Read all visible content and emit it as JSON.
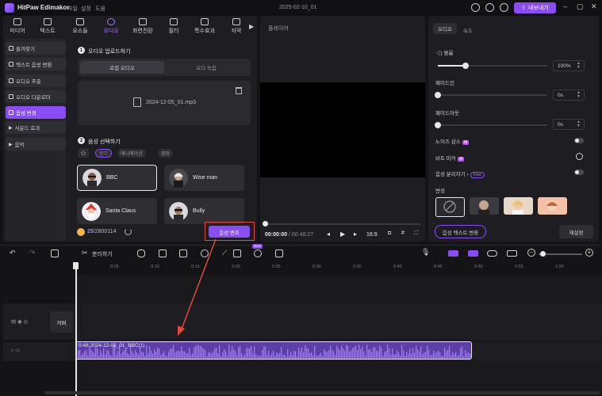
{
  "titlebar": {
    "app_name": "HitPaw Edimakor",
    "menu": [
      "파일",
      "설정",
      "도움"
    ],
    "document_title": "2025-02-10_01",
    "export_label": "내보내기"
  },
  "tool_tabs": [
    {
      "label": "미디어"
    },
    {
      "label": "텍스트"
    },
    {
      "label": "요소들"
    },
    {
      "label": "오디오"
    },
    {
      "label": "화면전환"
    },
    {
      "label": "필터"
    },
    {
      "label": "특수효과"
    },
    {
      "label": "자막"
    }
  ],
  "sidebar": {
    "items": [
      {
        "label": "즐겨찾기"
      },
      {
        "label": "텍스트 음성 변환"
      },
      {
        "label": "오디오 추출"
      },
      {
        "label": "오디오 다운로더"
      },
      {
        "label": "음성 변경"
      },
      {
        "label": "사운드 효과"
      },
      {
        "label": "음악"
      }
    ]
  },
  "upload": {
    "step_number": "1",
    "heading": "오디오 업로드하기",
    "options": [
      "로컬 오디오",
      "오디 녹음"
    ],
    "file_name": "2024-12-05_01.mp3"
  },
  "voice_select": {
    "step_number": "2",
    "heading": "음성 선택하기",
    "filters": [
      "인기",
      "애니메이션",
      "영화"
    ],
    "star": "☆",
    "voices": [
      {
        "name": "BBC"
      },
      {
        "name": "Wise man"
      },
      {
        "name": "Santa Claus"
      },
      {
        "name": "Bully"
      }
    ]
  },
  "footer": {
    "credits_used": "25",
    "credits_total": "/2800114",
    "convert_label": "음성 변조"
  },
  "player": {
    "label": "플레이어",
    "time_current": "00:00:00",
    "time_total": "/ 00:48:27",
    "aspect": "16:9"
  },
  "properties": {
    "tabs": [
      "오디오",
      "속도"
    ],
    "volume_label": "볼륨",
    "volume_value": "100%",
    "fade_in_label": "페이드인",
    "fade_in_value": "0s",
    "fade_out_label": "페이드아웃",
    "fade_out_value": "0s",
    "noise_label": "노이즈 감소",
    "beat_label": "비트 마커",
    "vocal_label": "음성 분리하기",
    "ai_badge": "AI",
    "free_badge": "Free",
    "voice_change_label": "변성",
    "speech_text_label": "음성 텍스트 변환",
    "reset_label": "재설정",
    "volume_level": 0.25,
    "fade_in_level": 0,
    "fade_out_level": 0
  },
  "timeline": {
    "split_label": "분리하기",
    "new_badge": "New",
    "ticks": [
      "0:05",
      "0:10",
      "0:15",
      "0:20",
      "0:25",
      "0:30",
      "0:35",
      "0:40",
      "0:45",
      "0:50",
      "0:55",
      "1:00"
    ],
    "cover_label": "커버",
    "clip_label": "0:48 2024-12-05_01_BBC(1)"
  }
}
